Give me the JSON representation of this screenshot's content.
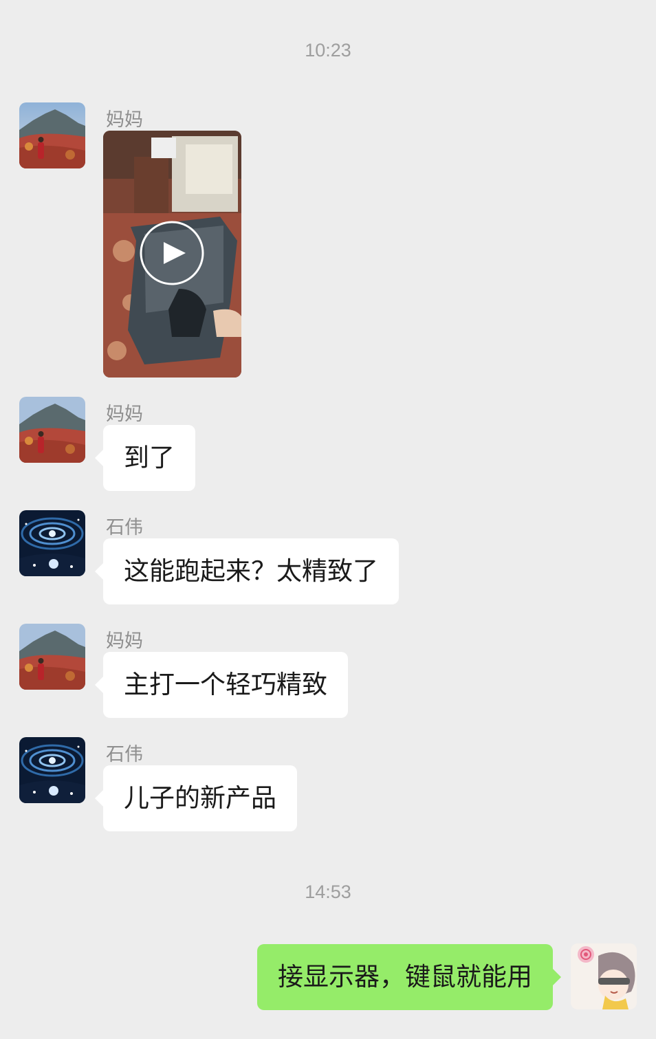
{
  "messages": [
    {
      "type": "time",
      "text": "10:23"
    },
    {
      "type": "video",
      "sender": "妈妈",
      "avatar": "mom-avatar"
    },
    {
      "type": "text",
      "sender": "妈妈",
      "text": "到了"
    },
    {
      "type": "text",
      "sender": "石伟",
      "text": "这能跑起来？太精致了"
    },
    {
      "type": "text",
      "sender": "妈妈",
      "text": "主打一个轻巧精致"
    },
    {
      "type": "text",
      "sender": "石伟",
      "text": "儿子的新产品"
    },
    {
      "type": "time",
      "text": "14:53"
    },
    {
      "type": "text",
      "sender": "self",
      "text": "接显示器，键鼠就能用"
    }
  ],
  "colors": {
    "background": "#ededed",
    "bubble_incoming": "#ffffff",
    "bubble_outgoing": "#95ec69",
    "timestamp": "#9e9e9e",
    "sender_name": "#8e8e8e"
  },
  "icons": {
    "video_overlay": "play-icon"
  }
}
